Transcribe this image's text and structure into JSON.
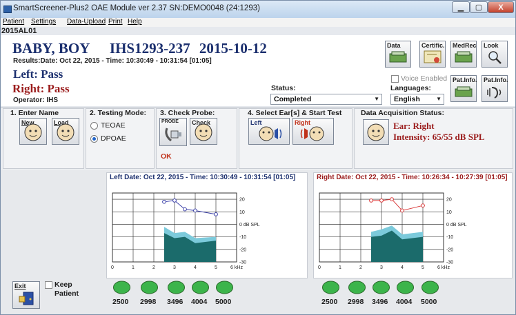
{
  "window": {
    "title": "SmartScreener-Plus2 OAE Module ver 2.37   SN:DEMO0048 (24:1293)",
    "minimize": "▁",
    "maximize": "▢",
    "close": "X"
  },
  "menu": [
    "Patient",
    "Settings",
    "Data-Upload",
    "Print",
    "Help"
  ],
  "session_id": "2015AL01",
  "patient": {
    "name": "BABY, BOY",
    "id": "IHS1293-237",
    "date": "2015-10-12",
    "results_date": "Results:Date: Oct 22, 2015 - Time: 10:30:49 - 10:31:54 [01:05]",
    "left_result": "Left: Pass",
    "right_result": "Right: Pass",
    "operator": "Operator: IHS"
  },
  "status": {
    "label": "Status:",
    "value": "Completed"
  },
  "voice_enabled": {
    "label": "Voice Enabled",
    "checked": false
  },
  "language": {
    "label": "Languages:",
    "value": "English"
  },
  "toolbar": {
    "data": "Data",
    "certific": "Certific.",
    "medrec": "MedRec",
    "look": "Look",
    "patinfo1": "Pat.Info.",
    "patinfo2": "Pat.Info."
  },
  "steps": {
    "enter_name": {
      "title": "1. Enter Name",
      "new": "New",
      "load": "Load"
    },
    "testing_mode": {
      "title": "2. Testing Mode:",
      "teoae": "TEOAE",
      "dpoae": "DPOAE",
      "selected": "DPOAE"
    },
    "check_probe": {
      "title": "3. Check Probe:",
      "probe": "PROBE",
      "check": "Check",
      "result": "OK"
    },
    "select_ear": {
      "title": "4. Select Ear[s] & Start Test",
      "left": "Left",
      "right": "Right"
    },
    "acquisition": {
      "title": "Data Acquisition Status:",
      "ear": "Ear: Right",
      "intensity": "Intensity: 65/55 dB SPL"
    }
  },
  "left_chart_title": "Left Date: Oct 22, 2015 - Time: 10:30:49 - 10:31:54 [01:05]",
  "right_chart_title": "Right Date: Oct 22, 2015 - Time: 10:26:34 - 10:27:39 [01:05]",
  "freq_labels": [
    "2500",
    "2998",
    "3496",
    "4004",
    "5000"
  ],
  "led_color": "#3cb44b",
  "exit_label": "Exit",
  "keep_patient": {
    "label1": "Keep",
    "label2": "Patient",
    "checked": false
  },
  "chart_data": [
    {
      "type": "area",
      "title": "Left Date: Oct 22, 2015 - Time: 10:30:49 - 10:31:54 [01:05]",
      "xlabel": "kHz",
      "ylabel": "dB SPL",
      "x_ticks": [
        "0",
        "1",
        "2",
        "3",
        "4",
        "5",
        "6"
      ],
      "y_ticks": [
        "20",
        "10",
        "0 dB SPL",
        "-10",
        "-20",
        "-30"
      ],
      "xlim": [
        0,
        6
      ],
      "ylim": [
        -30,
        25
      ],
      "series": [
        {
          "role": "dp-line",
          "color": "#3b40a8",
          "x": [
            2.5,
            3.0,
            3.5,
            4.0,
            5.0
          ],
          "y": [
            18,
            19,
            12,
            11,
            8
          ]
        },
        {
          "role": "noise-upper",
          "color": "#7ccadb",
          "x": [
            2.5,
            3.0,
            3.5,
            4.0,
            5.0
          ],
          "y": [
            -2,
            -7,
            -6,
            -11,
            -10
          ]
        },
        {
          "role": "noise-lower",
          "color": "#1b6b6b",
          "x": [
            2.5,
            3.0,
            3.5,
            4.0,
            5.0
          ],
          "y": [
            -7,
            -11,
            -10,
            -15,
            -13
          ]
        }
      ],
      "floor": -30,
      "grid": true
    },
    {
      "type": "area",
      "title": "Right Date: Oct 22, 2015 - Time: 10:26:34 - 10:27:39 [01:05]",
      "xlabel": "kHz",
      "ylabel": "dB SPL",
      "x_ticks": [
        "0",
        "1",
        "2",
        "3",
        "4",
        "5",
        "6"
      ],
      "y_ticks": [
        "20",
        "10",
        "0 dB SPL",
        "-10",
        "-20",
        "-30"
      ],
      "xlim": [
        0,
        6
      ],
      "ylim": [
        -30,
        25
      ],
      "series": [
        {
          "role": "dp-line",
          "color": "#d93a3a",
          "x": [
            2.5,
            3.0,
            3.5,
            4.0,
            5.0
          ],
          "y": [
            19,
            19,
            20,
            11,
            15
          ]
        },
        {
          "role": "noise-upper",
          "color": "#7ccadb",
          "x": [
            2.5,
            3.0,
            3.5,
            4.0,
            5.0
          ],
          "y": [
            -6,
            -4,
            -1,
            -8,
            -6
          ]
        },
        {
          "role": "noise-lower",
          "color": "#1b6b6b",
          "x": [
            2.5,
            3.0,
            3.5,
            4.0,
            5.0
          ],
          "y": [
            -10,
            -9,
            -5,
            -12,
            -10
          ]
        }
      ],
      "floor": -30,
      "grid": true
    }
  ]
}
